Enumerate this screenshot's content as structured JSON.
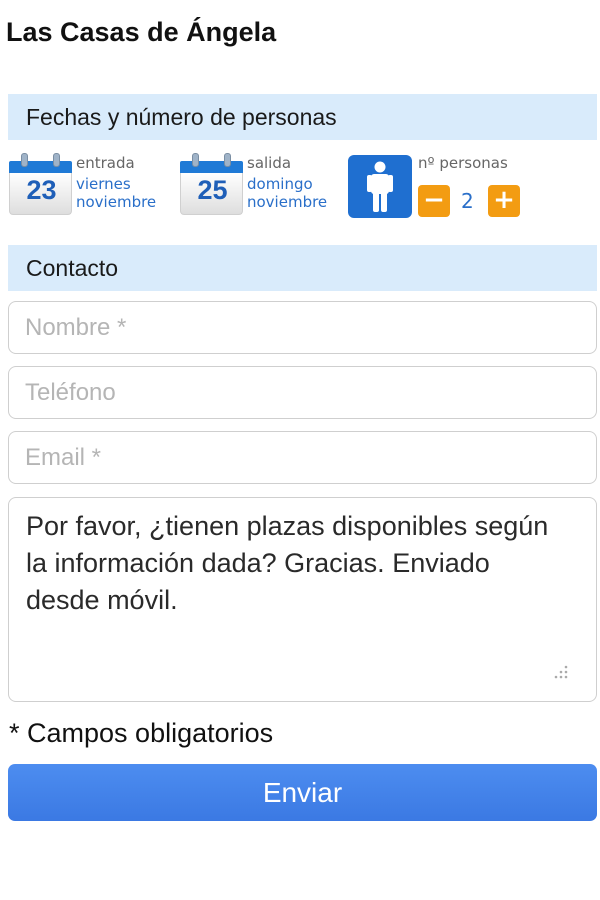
{
  "title": "Las Casas de Ángela",
  "dates_section": {
    "header": "Fechas y número de personas",
    "checkin": {
      "label": "entrada",
      "day": "23",
      "weekday": "viernes",
      "month": "noviembre"
    },
    "checkout": {
      "label": "salida",
      "day": "25",
      "weekday": "domingo",
      "month": "noviembre"
    },
    "guests": {
      "label": "nº personas",
      "count": "2",
      "decrement": "−",
      "increment": "+"
    }
  },
  "contact_section": {
    "header": "Contacto",
    "name_placeholder": "Nombre *",
    "phone_placeholder": "Teléfono",
    "email_placeholder": "Email *",
    "message": "Por favor, ¿tienen plazas disponibles según la información dada? Gracias. Enviado desde móvil."
  },
  "required_note": "* Campos obligatorios",
  "submit_label": "Enviar",
  "colors": {
    "accent": "#3b79e3",
    "header_bg": "#d9ebfb",
    "stepper": "#f39c12",
    "calendar": "#1f7ad6"
  }
}
